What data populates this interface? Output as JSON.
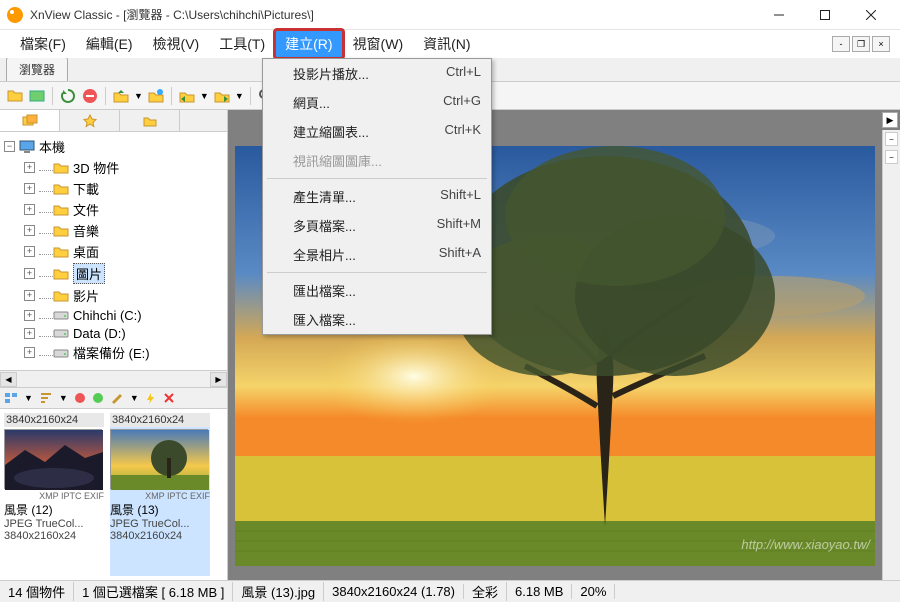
{
  "title": "XnView Classic - [瀏覽器 - C:\\Users\\chihchi\\Pictures\\]",
  "menu": {
    "file": "檔案(F)",
    "edit": "編輯(E)",
    "view": "檢視(V)",
    "tools": "工具(T)",
    "create": "建立(R)",
    "window": "視窗(W)",
    "info": "資訊(N)"
  },
  "dropdown": {
    "slideshow": "投影片播放...",
    "slideshow_sc": "Ctrl+L",
    "webpage": "網頁...",
    "webpage_sc": "Ctrl+G",
    "contact": "建立縮圖表...",
    "contact_sc": "Ctrl+K",
    "videothumb": "視訊縮圖圖庫...",
    "listing": "產生清單...",
    "listing_sc": "Shift+L",
    "multipage": "多頁檔案...",
    "multipage_sc": "Shift+M",
    "panorama": "全景相片...",
    "panorama_sc": "Shift+A",
    "export": "匯出檔案...",
    "import": "匯入檔案..."
  },
  "tab": "瀏覽器",
  "tree": {
    "root": "本機",
    "items": [
      {
        "label": "3D 物件",
        "indent": 1,
        "exp": "+"
      },
      {
        "label": "下載",
        "indent": 1,
        "exp": "+"
      },
      {
        "label": "文件",
        "indent": 1,
        "exp": "+"
      },
      {
        "label": "音樂",
        "indent": 1,
        "exp": "+"
      },
      {
        "label": "桌面",
        "indent": 1,
        "exp": "+"
      },
      {
        "label": "圖片",
        "indent": 1,
        "exp": "+",
        "selected": true
      },
      {
        "label": "影片",
        "indent": 1,
        "exp": "+"
      },
      {
        "label": "Chihchi (C:)",
        "indent": 1,
        "exp": "+",
        "drive": true
      },
      {
        "label": "Data (D:)",
        "indent": 1,
        "exp": "+",
        "drive": true
      },
      {
        "label": "檔案備份 (E:)",
        "indent": 1,
        "exp": "+",
        "drive": true
      }
    ]
  },
  "thumbs": [
    {
      "dim": "3840x2160x24",
      "name": "風景 (12)",
      "fmt": "JPEG TrueCol...",
      "dim2": "3840x2160x24",
      "meta": "XMP IPTC EXIF"
    },
    {
      "dim": "3840x2160x24",
      "name": "風景 (13)",
      "fmt": "JPEG TrueCol...",
      "dim2": "3840x2160x24",
      "meta": "XMP IPTC EXIF"
    }
  ],
  "status": {
    "objects": "14 個物件",
    "selected": "1 個已選檔案 [ 6.18 MB ]",
    "filename": "風景 (13).jpg",
    "dims": "3840x2160x24 (1.78)",
    "color": "全彩",
    "size": "6.18 MB",
    "zoom": "20%"
  },
  "watermark": "http://www.xiaoyao.tw/"
}
